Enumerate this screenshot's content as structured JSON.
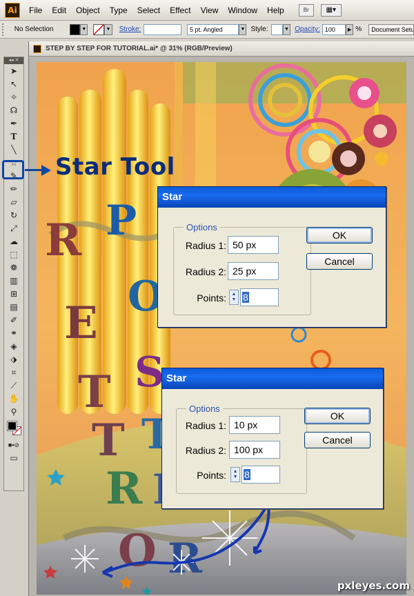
{
  "app": {
    "logo": "Ai"
  },
  "menu": [
    "File",
    "Edit",
    "Object",
    "Type",
    "Select",
    "Effect",
    "View",
    "Window",
    "Help"
  ],
  "bridge_label": "Br",
  "control_bar": {
    "selection": "No Selection",
    "stroke_label": "Stroke:",
    "brush": "5 pt. Angled",
    "style_label": "Style:",
    "opacity_label": "Opacity:",
    "opacity_value": "100",
    "opacity_unit": "%",
    "doc_setup": "Document Setup"
  },
  "document": {
    "title": "STEP BY STEP FOR TUTORIAL.ai* @ 31% (RGB/Preview)"
  },
  "tools": [
    "selection-tool",
    "direct-selection-tool",
    "magic-wand-tool",
    "lasso-tool",
    "pen-tool",
    "type-tool",
    "line-tool",
    "star-tool",
    "paintbrush-tool",
    "pencil-tool",
    "eraser-tool",
    "rotate-tool",
    "scale-tool",
    "warp-tool",
    "free-transform-tool",
    "symbol-sprayer-tool",
    "graph-tool",
    "mesh-tool",
    "gradient-tool",
    "eyedropper-tool",
    "blend-tool",
    "live-paint-tool",
    "live-paint-selection-tool",
    "crop-tool",
    "slice-tool",
    "hand-tool",
    "zoom-tool"
  ],
  "callout": {
    "text": "Star Tool"
  },
  "artwork": {
    "letters_left": [
      "R",
      "E",
      "T",
      "T",
      "R",
      "O"
    ],
    "letters_right": [
      "P",
      "O",
      "S",
      "T",
      "E",
      "R"
    ]
  },
  "dialog1": {
    "title": "Star",
    "group": "Options",
    "radius1_label": "Radius 1:",
    "radius1_value": "50 px",
    "radius2_label": "Radius 2:",
    "radius2_value": "25 px",
    "points_label": "Points:",
    "points_value": "8",
    "ok": "OK",
    "cancel": "Cancel"
  },
  "dialog2": {
    "title": "Star",
    "group": "Options",
    "radius1_label": "Radius 1:",
    "radius1_value": "10 px",
    "radius2_label": "Radius 2:",
    "radius2_value": "100 px",
    "points_label": "Points:",
    "points_value": "8",
    "ok": "OK",
    "cancel": "Cancel"
  },
  "watermark": "pxleyes.com",
  "colors": {
    "dialog_title": "#0a5bd7",
    "callout": "#0d47a5",
    "art_orange": "#f2a34b",
    "art_yellow": "#f8d64a"
  }
}
